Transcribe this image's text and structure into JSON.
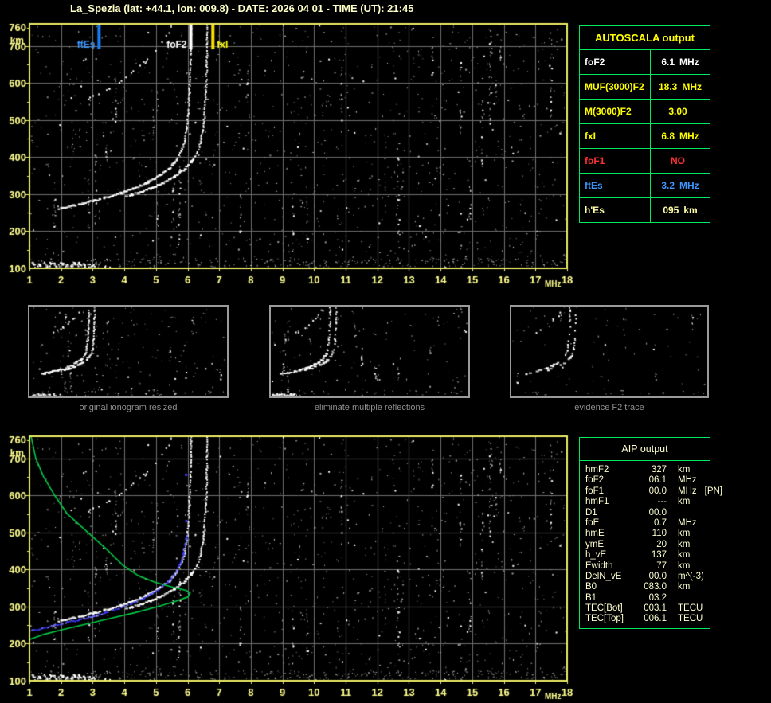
{
  "title": "La_Spezia (lat: +44.1, lon: 009.8) - DATE: 2026 04 01 - TIME (UT): 21:45",
  "colors": {
    "background": "#000000",
    "title_text": "#ffffc8",
    "axis_text": "#ffff8f",
    "plot_border": "#eeee66",
    "grid": "#6e6e6e",
    "noise_gray": "#9a9a9a",
    "echo_white": "#ffffff",
    "table_green": "#00e85c",
    "aip_text": "#ffffd0",
    "caption_gray": "#8f8f8f",
    "marker_blue": "#1a7cf0",
    "text_blue": "#3d96ff",
    "text_red": "#ff3030",
    "text_yellow": "#ffff00",
    "text_pale_yellow": "#ffffa8",
    "text_white": "#ffffff",
    "profile_green": "#00cc44",
    "restored_blue": "#3a3aff"
  },
  "autoscala": {
    "header": "AUTOSCALA output",
    "rows": [
      {
        "label": "foF2",
        "value": "6.1",
        "unit": "MHz",
        "color": "#ffffff"
      },
      {
        "label": "MUF(3000)F2",
        "value": "18.3",
        "unit": "MHz",
        "color": "#ffff00"
      },
      {
        "label": "M(3000)F2",
        "value": "3.00",
        "unit": "",
        "color": "#ffff00"
      },
      {
        "label": "fxI",
        "value": "6.8",
        "unit": "MHz",
        "color": "#ffff00"
      },
      {
        "label": "foF1",
        "value": "NO",
        "unit": "",
        "color": "#ff3030"
      },
      {
        "label": "ftEs",
        "value": "3.2",
        "unit": "MHz",
        "color": "#3d96ff"
      },
      {
        "label": "h'Es",
        "value": "095",
        "unit": "km",
        "color": "#ffffa8"
      }
    ]
  },
  "aip": {
    "header": "AIP output",
    "rows": [
      {
        "name": "hmF2",
        "value": "327",
        "unit": "km",
        "extra": ""
      },
      {
        "name": "foF2",
        "value": "06.1",
        "unit": "MHz",
        "extra": ""
      },
      {
        "name": "foF1",
        "value": "00.0",
        "unit": "MHz",
        "extra": "[PN]"
      },
      {
        "name": "hmF1",
        "value": "---",
        "unit": "km",
        "extra": ""
      },
      {
        "name": "D1",
        "value": "00.0",
        "unit": "",
        "extra": ""
      },
      {
        "name": "foE",
        "value": "0.7",
        "unit": "MHz",
        "extra": ""
      },
      {
        "name": "hmE",
        "value": "110",
        "unit": "km",
        "extra": ""
      },
      {
        "name": "ymE",
        "value": "20",
        "unit": "km",
        "extra": ""
      },
      {
        "name": "h_vE",
        "value": "137",
        "unit": "km",
        "extra": ""
      },
      {
        "name": "Ewidth",
        "value": "77",
        "unit": "km",
        "extra": ""
      },
      {
        "name": "DelN_vE",
        "value": "00.0",
        "unit": "m^(-3)",
        "extra": ""
      },
      {
        "name": "B0",
        "value": "083.0",
        "unit": "km",
        "extra": ""
      },
      {
        "name": "B1",
        "value": "03.2",
        "unit": "",
        "extra": ""
      },
      {
        "name": "TEC[Bot]",
        "value": "003.1",
        "unit": "TECU",
        "extra": ""
      },
      {
        "name": "TEC[Top]",
        "value": "006.1",
        "unit": "TECU",
        "extra": ""
      }
    ]
  },
  "thumbnails": [
    {
      "caption": "original ionogram resized",
      "seed": 101,
      "hop": 1.0,
      "es": 1.0,
      "noise": 1.0,
      "trace_skip": 0.05
    },
    {
      "caption": "eliminate multiple reflections",
      "seed": 102,
      "hop": 0.45,
      "es": 0.55,
      "noise": 0.8,
      "trace_skip": 0.2
    },
    {
      "caption": "evidence F2 trace",
      "seed": 103,
      "hop": 0.3,
      "es": 0.0,
      "noise": 0.45,
      "trace_skip": 0.45
    }
  ],
  "chart_data": [
    {
      "id": "ionogram-main",
      "type": "scatter",
      "xlabel": "MHz",
      "ylabel": "km",
      "xlim": [
        1,
        18
      ],
      "ylim": [
        100,
        760
      ],
      "x_ticks": [
        1,
        2,
        3,
        4,
        5,
        6,
        7,
        8,
        9,
        10,
        11,
        12,
        13,
        14,
        15,
        16,
        17,
        18
      ],
      "y_ticks": [
        100,
        200,
        300,
        400,
        500,
        600,
        700,
        760
      ],
      "grid": true,
      "legend": "none",
      "markers": [
        {
          "label": "ftEs",
          "freq": 3.2,
          "line_color": "#1a7cf0",
          "text_color": "#3d96ff",
          "side": "left"
        },
        {
          "label": "foF2",
          "freq": 6.1,
          "line_color": "#ffffff",
          "text_color": "#ffffff",
          "side": "left"
        },
        {
          "label": "fxI",
          "freq": 6.8,
          "line_color": "#ffe400",
          "text_color": "#ffff00",
          "side": "right"
        }
      ],
      "traces": {
        "f2_ordinary": [
          [
            1.95,
            261
          ],
          [
            2.3,
            268
          ],
          [
            2.7,
            275
          ],
          [
            3.1,
            284
          ],
          [
            3.5,
            293
          ],
          [
            3.9,
            303
          ],
          [
            4.3,
            315
          ],
          [
            4.7,
            330
          ],
          [
            5.05,
            347
          ],
          [
            5.4,
            368
          ],
          [
            5.65,
            392
          ],
          [
            5.8,
            415
          ],
          [
            5.9,
            442
          ],
          [
            5.97,
            475
          ],
          [
            6.02,
            515
          ],
          [
            6.06,
            575
          ],
          [
            6.09,
            650
          ],
          [
            6.11,
            760
          ]
        ],
        "x_mode_offset_mhz": 0.52,
        "x_mode_from_mhz": 3.85,
        "second_hop_from_mhz": 2.45,
        "es_layer": {
          "f_start": 1.0,
          "f_dense_end": 3.05,
          "f_sparse_end": 3.6,
          "km": 110
        },
        "noise": {
          "seed": 20260401,
          "speckles": 1150,
          "bright_dots": 45,
          "streaks": 26,
          "bottom_band_dots": 260
        }
      }
    },
    {
      "id": "profilogram",
      "type": "scatter",
      "xlabel": "MHz",
      "ylabel": "km",
      "xlim": [
        1,
        18
      ],
      "ylim": [
        100,
        760
      ],
      "x_ticks": [
        1,
        2,
        3,
        4,
        5,
        6,
        7,
        8,
        9,
        10,
        11,
        12,
        13,
        14,
        15,
        16,
        17,
        18
      ],
      "y_ticks": [
        100,
        200,
        300,
        400,
        500,
        600,
        700,
        760
      ],
      "grid": true,
      "profile_green": [
        [
          1.05,
          760
        ],
        [
          1.2,
          700
        ],
        [
          1.45,
          650
        ],
        [
          1.8,
          600
        ],
        [
          2.2,
          550
        ],
        [
          2.85,
          500
        ],
        [
          3.5,
          450
        ],
        [
          3.95,
          412
        ],
        [
          4.45,
          383
        ],
        [
          5.0,
          365
        ],
        [
          5.55,
          352
        ],
        [
          5.95,
          344
        ],
        [
          6.08,
          336
        ],
        [
          6.0,
          326
        ],
        [
          5.6,
          314
        ],
        [
          5.05,
          300
        ],
        [
          4.3,
          283
        ],
        [
          3.5,
          267
        ],
        [
          2.7,
          251
        ],
        [
          2.0,
          237
        ],
        [
          1.45,
          225
        ],
        [
          1.05,
          213
        ],
        [
          1.0,
          211
        ]
      ],
      "restored_trace_blue": [
        [
          1.02,
          234
        ],
        [
          1.4,
          241
        ],
        [
          1.8,
          249
        ],
        [
          2.2,
          257
        ],
        [
          2.6,
          265
        ],
        [
          3.0,
          273
        ],
        [
          3.4,
          283
        ],
        [
          3.8,
          294
        ],
        [
          4.2,
          307
        ],
        [
          4.55,
          320
        ],
        [
          4.9,
          336
        ],
        [
          5.2,
          353
        ],
        [
          5.45,
          372
        ],
        [
          5.65,
          394
        ],
        [
          5.78,
          418
        ],
        [
          5.87,
          443
        ],
        [
          5.93,
          466
        ],
        [
          5.96,
          484
        ],
        [
          5.98,
          496
        ]
      ],
      "restored_isolated": [
        [
          5.95,
          532
        ],
        [
          5.94,
          657
        ]
      ]
    }
  ]
}
